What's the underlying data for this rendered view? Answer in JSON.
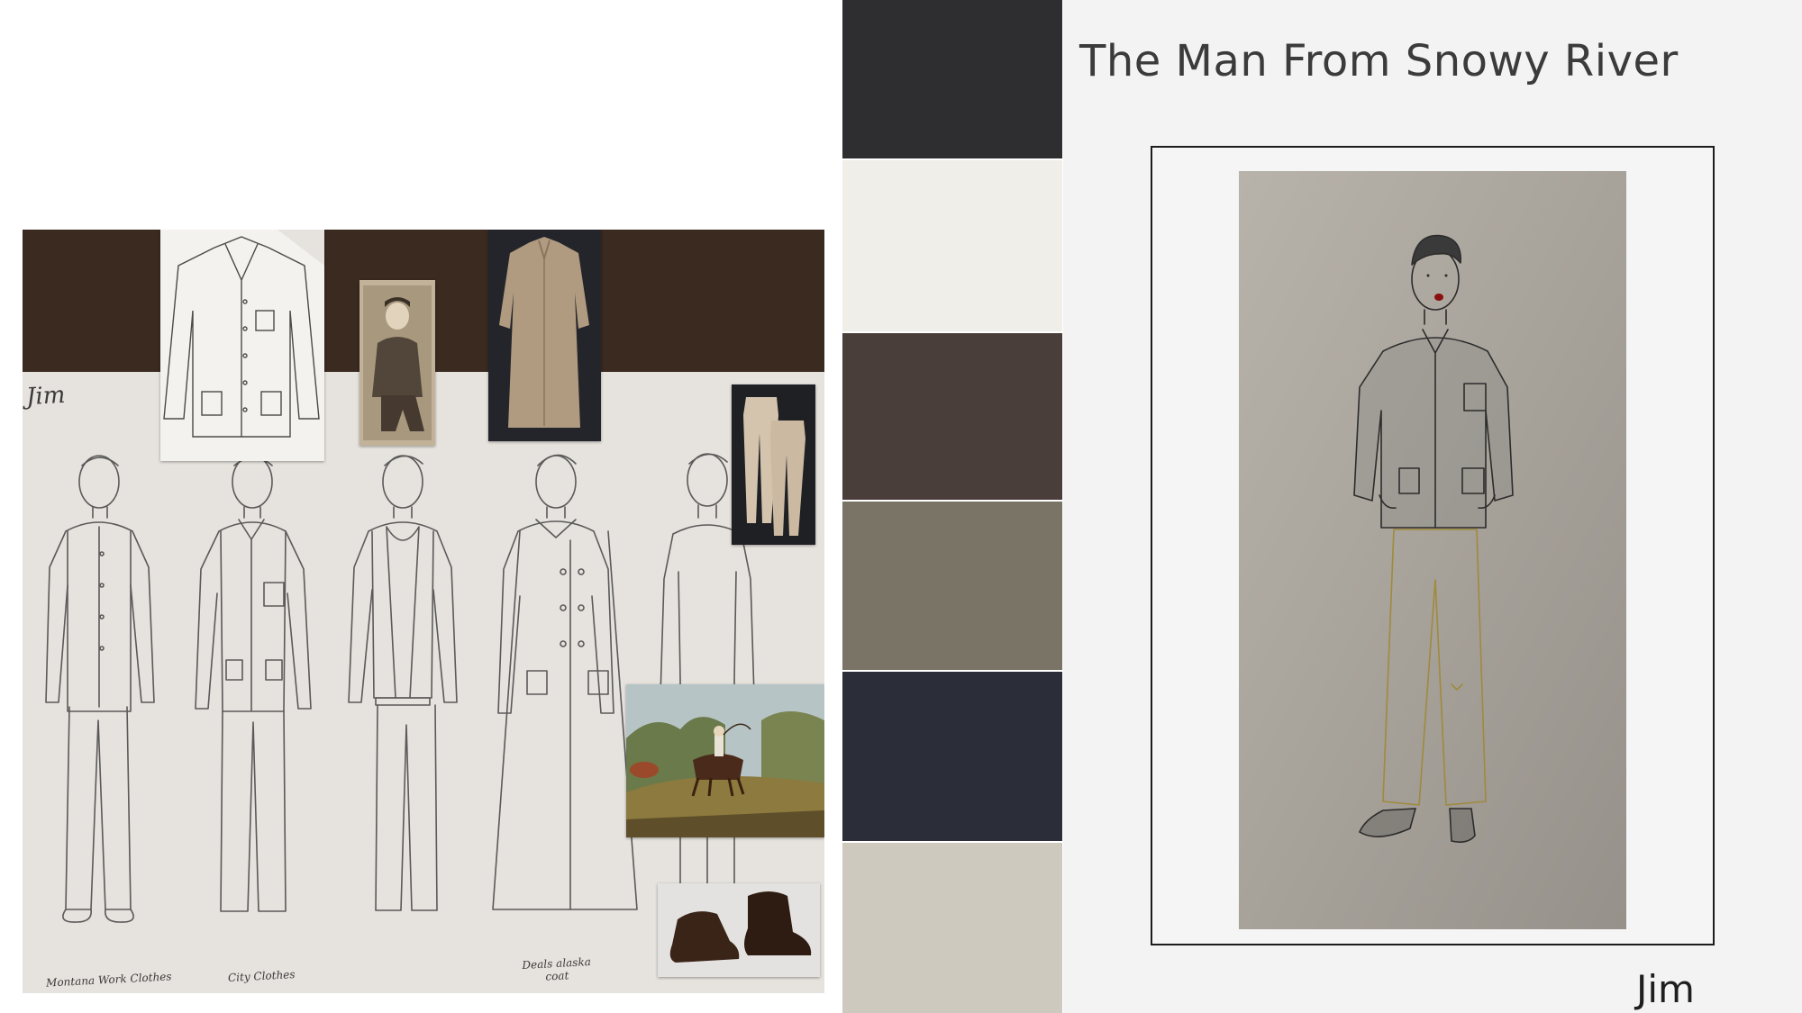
{
  "colors": {
    "board_band": "#3a2a20",
    "board_paper": "#e6e2dd",
    "sketch_line": "#5a5a5a",
    "card_art_bg": "#a9a49b",
    "trouser_line": "#a08a3c",
    "accent_lips": "#8a1010"
  },
  "board": {
    "jim_note": "Jim",
    "captions": [
      "Montana Work Clothes",
      "City Clothes",
      "Deals alaska coat"
    ]
  },
  "palette": {
    "swatches": [
      "#2e2e30",
      "#f0eee9",
      "#4a3e3a",
      "#7a7466",
      "#2b2e38",
      "#cdc9bf"
    ]
  },
  "card": {
    "title": "The Man From Snowy River",
    "label": "Jim"
  }
}
